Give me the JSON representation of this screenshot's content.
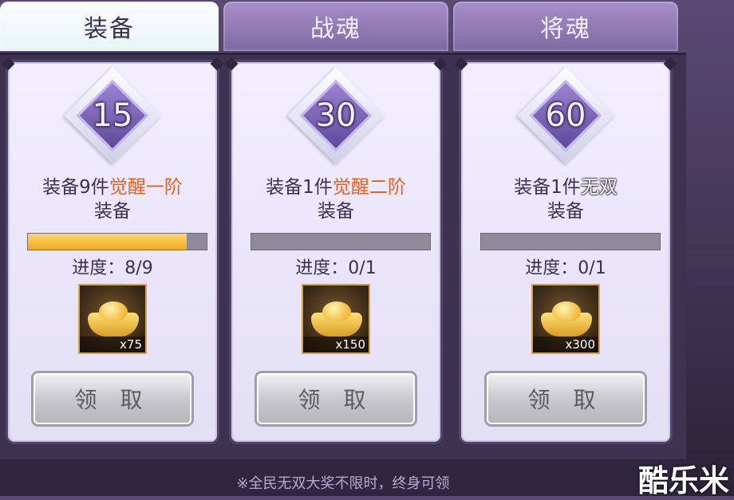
{
  "tabs": [
    {
      "label": "装备",
      "active": true
    },
    {
      "label": "战魂",
      "active": false
    },
    {
      "label": "将魂",
      "active": false
    }
  ],
  "cards": [
    {
      "level": "15",
      "task_prefix": "装备9件",
      "task_highlight": "觉醒一阶",
      "task_line2": "装备",
      "highlight_color": "#e2631e",
      "progress_text": "进度：8/9",
      "progress_fraction": 0.889,
      "reward_qty": "x75",
      "claim_label": "领 取"
    },
    {
      "level": "30",
      "task_prefix": "装备1件",
      "task_highlight": "觉醒二阶",
      "task_line2": "装备",
      "highlight_color": "#e2631e",
      "progress_text": "进度：0/1",
      "progress_fraction": 0,
      "reward_qty": "x150",
      "claim_label": "领 取"
    },
    {
      "level": "60",
      "task_prefix": "装备1件",
      "task_highlight": "无双",
      "task_line2": "装备",
      "highlight_color": "#ffffff",
      "progress_text": "进度：0/1",
      "progress_fraction": 0,
      "reward_qty": "x300",
      "claim_label": "领 取"
    }
  ],
  "footer_note": "※全民无双大奖不限时，终身可领",
  "watermark": "酷乐米"
}
